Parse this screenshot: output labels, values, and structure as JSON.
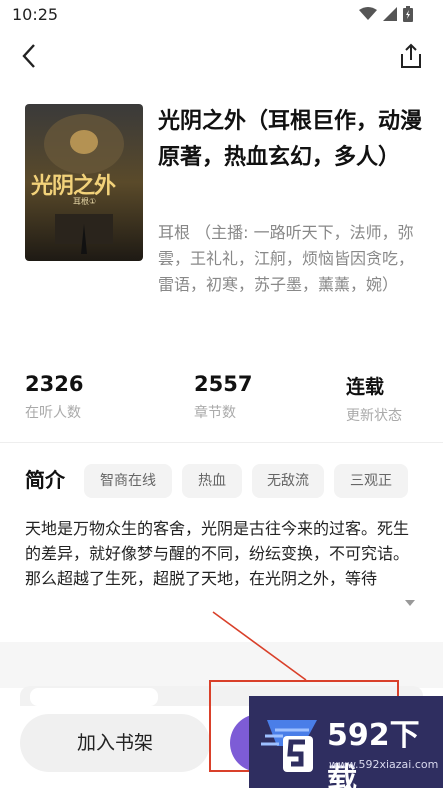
{
  "status": {
    "time": "10:25"
  },
  "book": {
    "title": "光阴之外（耳根巨作，动漫原著，热血玄幻，多人）",
    "authors": "耳根 （主播: 一路听天下，法师，弥雲，王礼礼，江舸，烦恼皆因贪吃，雷语，初寒，苏子墨，薰薰，婉）",
    "cover_text": "光阴之外",
    "cover_subtext": "耳根①"
  },
  "stats": [
    {
      "value": "2326",
      "label": "在听人数"
    },
    {
      "value": "2557",
      "label": "章节数"
    },
    {
      "value": "连载",
      "label": "更新状态"
    }
  ],
  "intro": {
    "heading": "简介",
    "tags": [
      "智商在线",
      "热血",
      "无敌流",
      "三观正"
    ],
    "text": "天地是万物众生的客舍，光阴是古往今来的过客。死生的差异，就好像梦与醒的不同，纷纭变换，不可究诘。那么超越了生死，超脱了天地，在光阴之外，等待"
  },
  "actions": {
    "bookshelf_label": "加入书架"
  },
  "watermark": {
    "brand": "592下载",
    "url": "www.592xiazai.com"
  },
  "colors": {
    "accent": "#7d5cd6",
    "annotation": "#d9402a"
  },
  "icons": [
    "wifi-icon",
    "signal-icon",
    "battery-icon",
    "back-arrow-icon",
    "share-icon",
    "expand-arrow-icon"
  ]
}
